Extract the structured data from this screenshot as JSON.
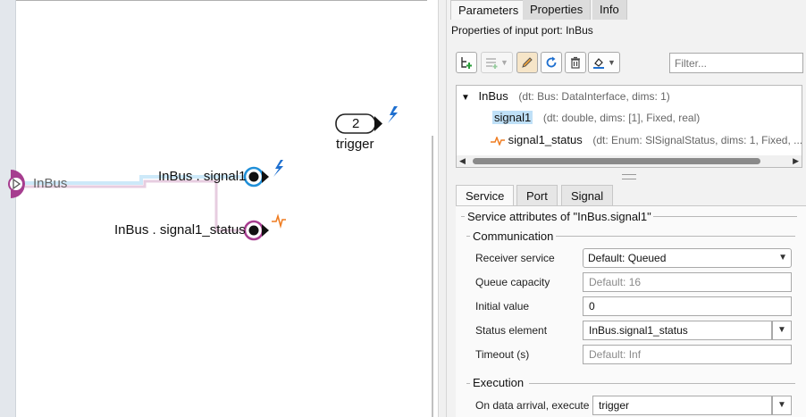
{
  "canvas": {
    "inport_label": "InBus",
    "trigger_port": {
      "number": "2",
      "label": "trigger"
    },
    "ports": [
      {
        "label": "InBus . signal1"
      },
      {
        "label": "InBus . signal1_status"
      }
    ]
  },
  "panel": {
    "tabs": [
      "Parameters",
      "Properties",
      "Info"
    ],
    "active_tab": "Parameters",
    "title": "Properties of input port: InBus",
    "filter_placeholder": "Filter...",
    "tree": {
      "root": {
        "name": "InBus",
        "meta": "(dt: Bus: DataInterface, dims: 1)"
      },
      "children": [
        {
          "name": "signal1",
          "meta": "(dt: double, dims: [1], Fixed, real)",
          "selected": true
        },
        {
          "name": "signal1_status",
          "meta": "(dt: Enum: SlSignalStatus, dims: 1, Fixed, ..."
        }
      ]
    },
    "sub_tabs": [
      "Service",
      "Port",
      "Signal"
    ],
    "active_sub_tab": "Service",
    "service": {
      "header": "Service attributes of \"InBus.signal1\"",
      "communication_header": "Communication",
      "receiver_service": {
        "label": "Receiver service",
        "value": "Default: Queued"
      },
      "queue_capacity": {
        "label": "Queue capacity",
        "placeholder": "Default: 16"
      },
      "initial_value": {
        "label": "Initial value",
        "value": "0"
      },
      "status_element": {
        "label": "Status element",
        "value": "InBus.signal1_status"
      },
      "timeout": {
        "label": "Timeout (s)",
        "placeholder": "Default: Inf"
      },
      "execution_header": "Execution",
      "on_data_arrival": {
        "label": "On data arrival, execute",
        "value": "trigger"
      }
    }
  },
  "colors": {
    "port_blue": "#1f8fd8",
    "port_magenta": "#a63d8f",
    "event_orange": "#ef7d22",
    "bolt_blue": "#1e6fcf",
    "selection": "#bfe0f7"
  }
}
